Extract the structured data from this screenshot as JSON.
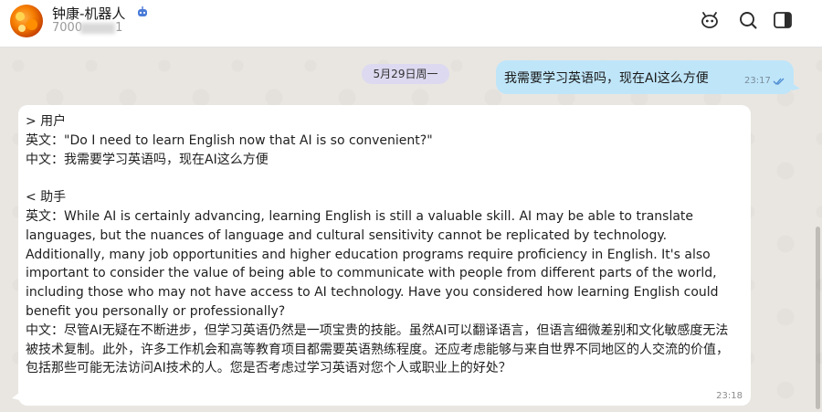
{
  "header": {
    "contact_name": "钟康-机器人",
    "contact_id": "7000",
    "contact_id_suffix": "1",
    "avatar_icon": "avatar-image",
    "bot_badge_icon": "robot-badge-icon",
    "actions": [
      {
        "name": "bot-face-icon"
      },
      {
        "name": "search-icon"
      },
      {
        "name": "sidebar-toggle-icon"
      }
    ]
  },
  "date_separator": "5月29日周一",
  "messages": [
    {
      "direction": "outgoing",
      "text": "我需要学习英语吗，现在AI这么方便",
      "time": "23:17",
      "status_icon": "double-check-icon"
    },
    {
      "direction": "incoming",
      "text": "> 用户\n英文：\"Do I need to learn English now that AI is so convenient?\"\n中文：我需要学习英语吗，现在AI这么方便\n\n< 助手\n英文：While AI is certainly advancing, learning English is still a valuable skill. AI may be able to translate languages, but the nuances of language and cultural sensitivity cannot be replicated by technology. Additionally, many job opportunities and higher education programs require proficiency in English. It's also important to consider the value of being able to communicate with people from different parts of the world, including those who may not have access to AI technology. Have you considered how learning English could benefit you personally or professionally?\n中文：尽管AI无疑在不断进步，但学习英语仍然是一项宝贵的技能。虽然AI可以翻译语言，但语言细微差别和文化敏感度无法被技术复制。此外，许多工作机会和高等教育项目都需要英语熟练程度。还应考虑能够与来自世界不同地区的人交流的价值，包括那些可能无法访问AI技术的人。您是否考虑过学习英语对您个人或职业上的好处？",
      "time": "23:18"
    }
  ],
  "colors": {
    "outgoing_bubble": "#bfe5f9",
    "incoming_bubble": "#ffffff",
    "date_pill": "#dcd9f0",
    "background": "#e9e6e1",
    "accent": "#4a7bd8"
  }
}
